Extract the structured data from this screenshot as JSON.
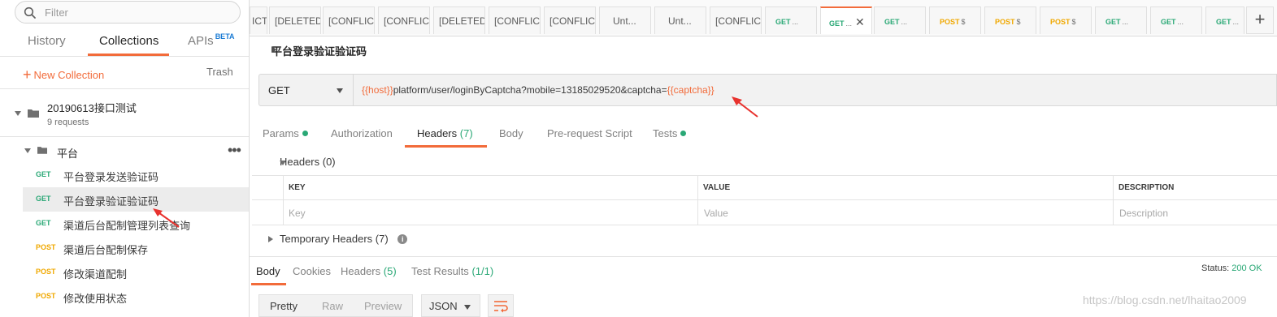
{
  "sidebar": {
    "filter_placeholder": "Filter",
    "tabs": [
      {
        "label": "History"
      },
      {
        "label": "Collections"
      },
      {
        "label": "APIs",
        "badge": "BETA"
      }
    ],
    "new_collection_label": "New Collection",
    "trash_label": "Trash",
    "collection": {
      "name": "20190613接口测试",
      "count": "9 requests"
    },
    "folder": {
      "name": "平台"
    },
    "requests": [
      {
        "method": "GET",
        "name": "平台登录发送验证码"
      },
      {
        "method": "GET",
        "name": "平台登录验证验证码"
      },
      {
        "method": "GET",
        "name": "渠道后台配制管理列表查询"
      },
      {
        "method": "POST",
        "name": "渠道后台配制保存"
      },
      {
        "method": "POST",
        "name": "修改渠道配制"
      },
      {
        "method": "POST",
        "name": "修改使用状态"
      }
    ]
  },
  "tabs": [
    {
      "label": "ICT"
    },
    {
      "label": "[DELETED]"
    },
    {
      "label": "[CONFLICT"
    },
    {
      "label": "[CONFLICT"
    },
    {
      "label": "[DELETED]"
    },
    {
      "label": "[CONFLICT"
    },
    {
      "label": "[CONFLICT"
    },
    {
      "label": "Unt..."
    },
    {
      "label": "Unt..."
    },
    {
      "label": "[CONFLICT"
    },
    {
      "method": "GET",
      "label": "..."
    },
    {
      "method": "GET",
      "label": "..."
    },
    {
      "method": "GET",
      "label": "..."
    },
    {
      "method": "POST",
      "label": "$"
    },
    {
      "method": "POST",
      "label": "$"
    },
    {
      "method": "POST",
      "label": "$"
    },
    {
      "method": "GET",
      "label": "..."
    },
    {
      "method": "GET",
      "label": "..."
    },
    {
      "method": "GET",
      "label": "..."
    }
  ],
  "request": {
    "title": "平台登录验证验证码",
    "method": "GET",
    "url_var1": "{{host}}",
    "url_mid": "platform/user/loginByCaptcha?mobile=13185029520&captcha=",
    "url_var2": "{{captcha}}"
  },
  "request_tabs": {
    "params": "Params",
    "authorization": "Authorization",
    "headers": "Headers",
    "headers_count": "(7)",
    "body": "Body",
    "prerequest": "Pre-request Script",
    "tests": "Tests"
  },
  "headers_section": {
    "title": "Headers (0)",
    "col_key": "KEY",
    "col_value": "VALUE",
    "col_desc": "DESCRIPTION",
    "ph_key": "Key",
    "ph_value": "Value",
    "ph_desc": "Description",
    "temp_title": "Temporary Headers",
    "temp_count": "(7)"
  },
  "response": {
    "tabs": {
      "body": "Body",
      "cookies": "Cookies",
      "headers": "Headers",
      "headers_count": "(5)",
      "tests": "Test Results",
      "tests_count": "(1/1)"
    },
    "status_label": "Status:",
    "status_value": "200 OK",
    "formats": [
      "Pretty",
      "Raw",
      "Preview"
    ],
    "lang": "JSON"
  },
  "watermark": "https://blog.csdn.net/lhaitao2009",
  "colors": {
    "accent": "#f26b3a",
    "get": "#2aa876",
    "post": "#f0a800"
  }
}
